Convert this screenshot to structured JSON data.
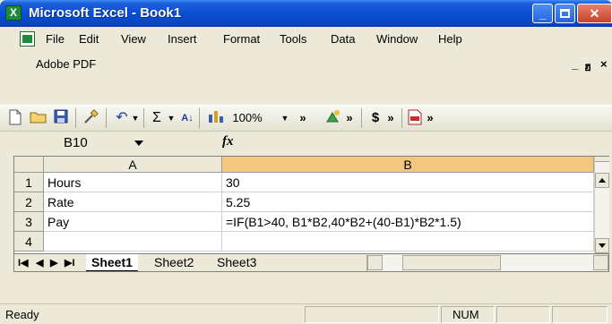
{
  "window": {
    "title": "Microsoft Excel - Book1",
    "app_icon_letter": "X",
    "minimize_label": "_",
    "close_label": "✕"
  },
  "menubar": {
    "items": [
      "File",
      "Edit",
      "View",
      "Insert",
      "Format",
      "Tools",
      "Data",
      "Window",
      "Help"
    ],
    "second_row_item": "Adobe PDF",
    "restore_label": "_ ",
    "restore_glyph": "🗗",
    "close_label": "×"
  },
  "toolbar": {
    "zoom": "100%",
    "sum_glyph": "Σ",
    "sort_glyph": "A↓",
    "more_glyph": "»",
    "currency_glyph": "$"
  },
  "formula_bar": {
    "name_box": "B10",
    "fx_label": "fx",
    "formula": ""
  },
  "grid": {
    "columns": [
      "A",
      "B"
    ],
    "selected_column": "B",
    "rows": [
      {
        "num": "1",
        "a": "Hours",
        "b": "30"
      },
      {
        "num": "2",
        "a": "Rate",
        "b": "5.25"
      },
      {
        "num": "3",
        "a": "Pay",
        "b": "=IF(B1>40, B1*B2,40*B2+(40-B1)*B2*1.5)"
      },
      {
        "num": "4",
        "a": "",
        "b": ""
      }
    ]
  },
  "sheets": {
    "tabs": [
      "Sheet1",
      "Sheet2",
      "Sheet3"
    ],
    "active": "Sheet1",
    "nav_first": "I◀",
    "nav_prev": "◀",
    "nav_next": "▶",
    "nav_last": "▶I"
  },
  "status": {
    "left": "Ready",
    "num": "NUM"
  }
}
